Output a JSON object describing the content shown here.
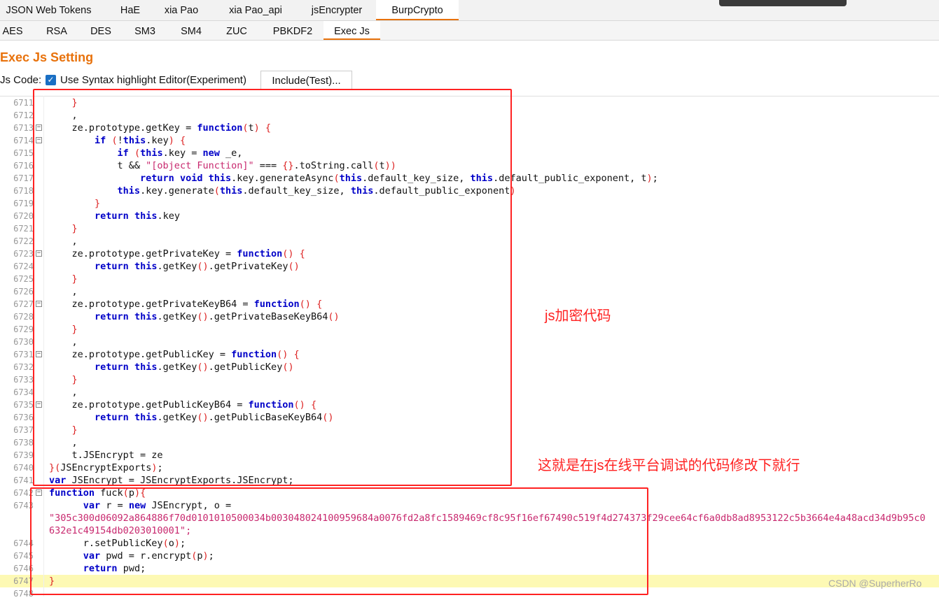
{
  "top_tabs": [
    {
      "label": "JSON Web Tokens"
    },
    {
      "label": "HaE"
    },
    {
      "label": "xia Pao"
    },
    {
      "label": "xia Pao_api"
    },
    {
      "label": "jsEncrypter"
    },
    {
      "label": "BurpCrypto",
      "active": true
    }
  ],
  "sub_tabs": [
    {
      "label": "AES"
    },
    {
      "label": "RSA"
    },
    {
      "label": "DES"
    },
    {
      "label": "SM3"
    },
    {
      "label": "SM4"
    },
    {
      "label": "ZUC"
    },
    {
      "label": "PBKDF2"
    },
    {
      "label": "Exec Js",
      "active": true
    }
  ],
  "settings": {
    "title": "Exec Js Setting",
    "js_code_label": "Js Code:",
    "syntax_checkbox_label": "Use Syntax highlight Editor(Experiment)",
    "syntax_checked": true,
    "include_button": "Include(Test)..."
  },
  "colors": {
    "accent": "#e8720c",
    "annotation": "#ff2222",
    "keyword": "#0000c8",
    "string": "#c8286e"
  },
  "editor": {
    "lines": [
      {
        "n": "6711",
        "t": "    }"
      },
      {
        "n": "6712",
        "t": "    ,"
      },
      {
        "n": "6713",
        "t": "    ze.prototype.getKey = function(t) {",
        "fold": true
      },
      {
        "n": "6714",
        "t": "        if (!this.key) {",
        "fold": true
      },
      {
        "n": "6715",
        "t": "            if (this.key = new _e,"
      },
      {
        "n": "6716",
        "t": "            t && \"[object Function]\" === {}.toString.call(t))"
      },
      {
        "n": "6717",
        "t": "                return void this.key.generateAsync(this.default_key_size, this.default_public_exponent, t);"
      },
      {
        "n": "6718",
        "t": "            this.key.generate(this.default_key_size, this.default_public_exponent)"
      },
      {
        "n": "6719",
        "t": "        }"
      },
      {
        "n": "6720",
        "t": "        return this.key"
      },
      {
        "n": "6721",
        "t": "    }"
      },
      {
        "n": "6722",
        "t": "    ,"
      },
      {
        "n": "6723",
        "t": "    ze.prototype.getPrivateKey = function() {",
        "fold": true
      },
      {
        "n": "6724",
        "t": "        return this.getKey().getPrivateKey()"
      },
      {
        "n": "6725",
        "t": "    }"
      },
      {
        "n": "6726",
        "t": "    ,"
      },
      {
        "n": "6727",
        "t": "    ze.prototype.getPrivateKeyB64 = function() {",
        "fold": true
      },
      {
        "n": "6728",
        "t": "        return this.getKey().getPrivateBaseKeyB64()"
      },
      {
        "n": "6729",
        "t": "    }"
      },
      {
        "n": "6730",
        "t": "    ,"
      },
      {
        "n": "6731",
        "t": "    ze.prototype.getPublicKey = function() {",
        "fold": true
      },
      {
        "n": "6732",
        "t": "        return this.getKey().getPublicKey()"
      },
      {
        "n": "6733",
        "t": "    }"
      },
      {
        "n": "6734",
        "t": "    ,"
      },
      {
        "n": "6735",
        "t": "    ze.prototype.getPublicKeyB64 = function() {",
        "fold": true
      },
      {
        "n": "6736",
        "t": "        return this.getKey().getPublicBaseKeyB64()"
      },
      {
        "n": "6737",
        "t": "    }"
      },
      {
        "n": "6738",
        "t": "    ,"
      },
      {
        "n": "6739",
        "t": "    t.JSEncrypt = ze"
      },
      {
        "n": "6740",
        "t": "}(JSEncryptExports);"
      },
      {
        "n": "6741",
        "t": "var JSEncrypt = JSEncryptExports.JSEncrypt;"
      },
      {
        "n": "6742",
        "t": "function fuck(p){",
        "fold": true
      },
      {
        "n": "6743",
        "t": "      var r = new JSEncrypt, o ="
      },
      {
        "n": "",
        "t": "\"305c300d06092a864886f70d0101010500034b003048024100959684a0076fd2a8fc1589469cf8c95f16ef67490c519f4d274373f29cee64cf6a0db8ad8953122c5b3664e4a48acd34d9b95c0"
      },
      {
        "n": "",
        "t": "632e1c49154db0203010001\";"
      },
      {
        "n": "6744",
        "t": "      r.setPublicKey(o);"
      },
      {
        "n": "6745",
        "t": "      var pwd = r.encrypt(p);"
      },
      {
        "n": "6746",
        "t": "      return pwd;"
      },
      {
        "n": "6747",
        "t": "}",
        "highlight": true
      },
      {
        "n": "6748",
        "t": ""
      }
    ]
  },
  "annotations": {
    "note1": "js加密代码",
    "note2": "这就是在js在线平台调试的代码修改下就行"
  },
  "watermark": "CSDN @SuperherRo"
}
